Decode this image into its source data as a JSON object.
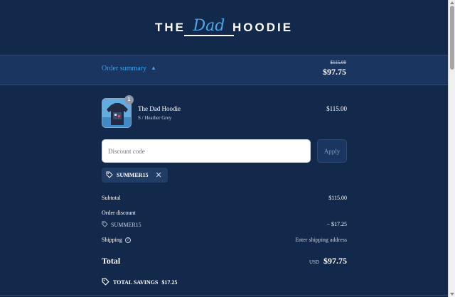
{
  "logo": {
    "word_left": "THE",
    "script": "Dad",
    "word_right": "HOODIE"
  },
  "summary": {
    "toggle_label": "Order summary",
    "old_total": "$115.00",
    "total": "$97.75"
  },
  "cart": {
    "items": [
      {
        "name": "The Dad Hoodie",
        "variant": "S / Heather Grey",
        "price": "$115.00",
        "quantity": "1"
      }
    ]
  },
  "discount": {
    "placeholder": "Discount code",
    "value": "",
    "apply_label": "Apply",
    "applied_code": "SUMMER15"
  },
  "totals": {
    "subtotal_label": "Subtotal",
    "subtotal_value": "$115.00",
    "order_discount_label": "Order discount",
    "discount_code": "SUMMER15",
    "discount_value": "− $17.25",
    "shipping_label": "Shipping",
    "shipping_value": "Enter shipping address",
    "total_label": "Total",
    "currency": "USD",
    "total_value": "$97.75",
    "savings_label": "TOTAL SAVINGS",
    "savings_value": "$17.25"
  },
  "colors": {
    "background": "#13294c",
    "summary_bar": "#1a3660",
    "accent": "#3fa0e6"
  },
  "icons": {
    "toggle": "chevron-up-icon",
    "tag": "tag-icon",
    "remove": "close-icon",
    "info": "info-icon"
  }
}
